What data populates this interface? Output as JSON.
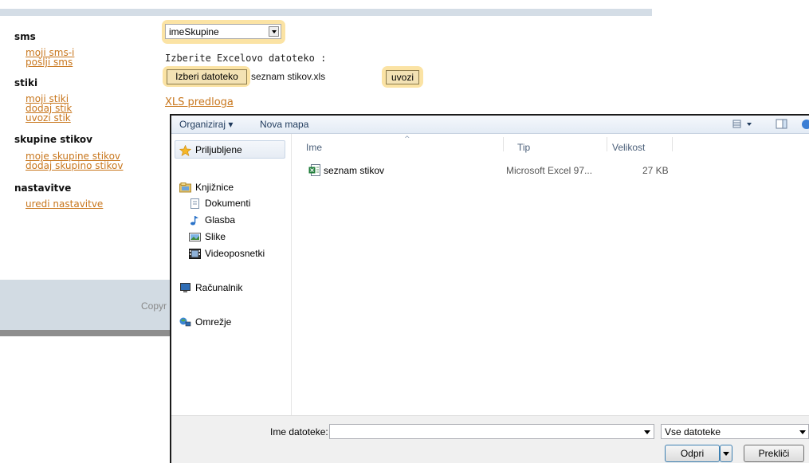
{
  "nav": {
    "sections": [
      {
        "title": "sms",
        "links": [
          "moji sms-i",
          "pošlji sms"
        ]
      },
      {
        "title": "stiki",
        "links": [
          "moji stiki",
          "dodaj stik",
          "uvozi stik"
        ]
      },
      {
        "title": "skupine stikov",
        "links": [
          "moje skupine stikov",
          "dodaj skupino stikov"
        ]
      },
      {
        "title": "nastavitve",
        "links": [
          "uredi nastavitve"
        ]
      }
    ]
  },
  "form": {
    "group_select_value": "imeSkupine",
    "excel_label": "Izberite Excelovo datoteko :",
    "choose_file_label": "Izberi datoteko",
    "chosen_file_name": "seznam stikov.xls",
    "import_label": "uvozi",
    "template_link": "XLS predloga"
  },
  "footer": {
    "copyright_partial": "Copyr"
  },
  "dialog": {
    "toolbar": {
      "organize": "Organiziraj ▾",
      "new_folder": "Nova mapa"
    },
    "nav": {
      "favorites": "Priljubljene",
      "libraries": "Knjižnice",
      "library_items": [
        "Dokumenti",
        "Glasba",
        "Slike",
        "Videoposnetki"
      ],
      "computer": "Računalnik",
      "network": "Omrežje"
    },
    "columns": {
      "name": "Ime",
      "type": "Tip",
      "size": "Velikost"
    },
    "files": [
      {
        "name": "seznam stikov",
        "type": "Microsoft Excel 97...",
        "size": "27 KB"
      }
    ],
    "filename_label": "Ime datoteke:",
    "filename_value": "",
    "filetype_value": "Vse datoteke",
    "open_label": "Odpri",
    "cancel_label": "Prekliči"
  },
  "colors": {
    "link": "#c8761c",
    "highlight": "#fbe3a4",
    "toolbar_text": "#1e395b"
  },
  "icons": [
    "star-icon",
    "library-icon",
    "document-icon",
    "music-icon",
    "picture-icon",
    "video-icon",
    "computer-icon",
    "network-icon",
    "excel-file-icon",
    "view-options-icon",
    "preview-pane-icon",
    "help-icon"
  ]
}
